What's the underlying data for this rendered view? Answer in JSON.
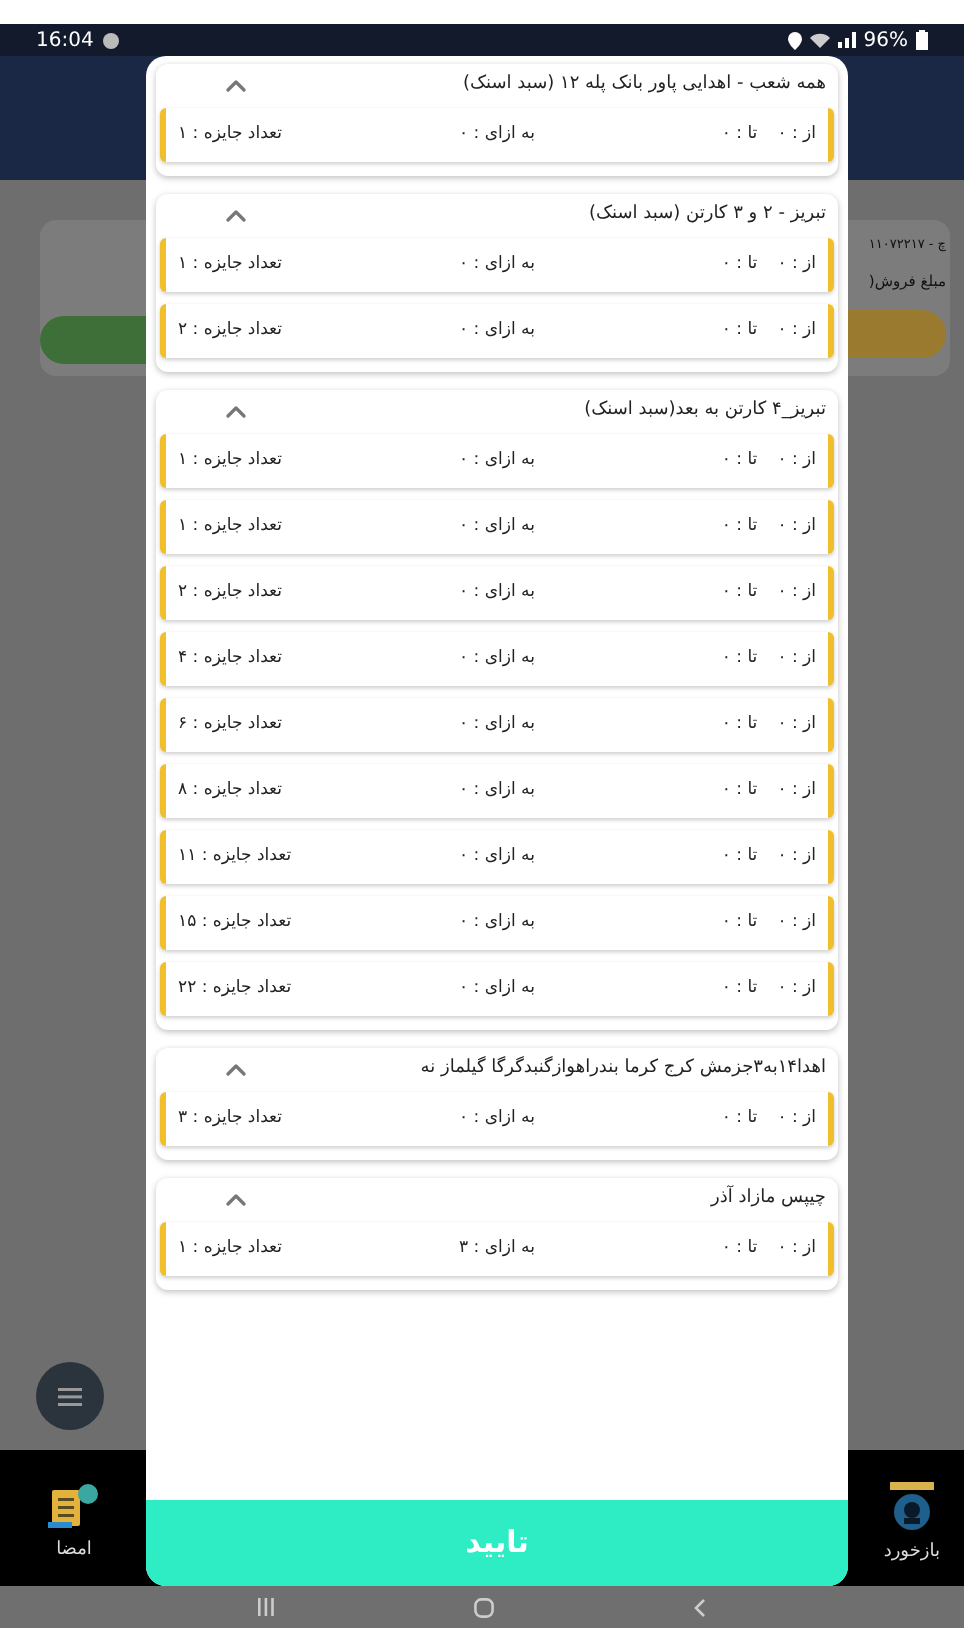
{
  "status_bar": {
    "time": "16:04",
    "battery": "96%"
  },
  "background": {
    "order_number": "چ - ۱۱۰۷۲۲۱۷",
    "amount_label": "مبلغ فروش("
  },
  "bottom_nav": [
    {
      "kind": "feedback",
      "label": "بازخورد"
    },
    {
      "kind": "signature",
      "label": "امضا"
    }
  ],
  "groups": [
    {
      "title": "همه شعب - اهدایی پاور بانک پله ۱۲ (سبد اسنک)",
      "expanded": true,
      "rows": [
        {
          "from": "از : ۰",
          "to": "تا : ۰",
          "per": "به ازای : ۰",
          "count": "تعداد جایزه : ۱"
        }
      ]
    },
    {
      "title": "تبریز - ۲ و ۳ کارتن  (سبد اسنک)",
      "expanded": true,
      "rows": [
        {
          "from": "از : ۰",
          "to": "تا : ۰",
          "per": "به ازای : ۰",
          "count": "تعداد جایزه : ۱"
        },
        {
          "from": "از : ۰",
          "to": "تا : ۰",
          "per": "به ازای : ۰",
          "count": "تعداد جایزه : ۲"
        }
      ]
    },
    {
      "title": "تبریز_۴ کارتن به بعد(سبد اسنک)",
      "expanded": true,
      "rows": [
        {
          "from": "از : ۰",
          "to": "تا : ۰",
          "per": "به ازای : ۰",
          "count": "تعداد جایزه : ۱"
        },
        {
          "from": "از : ۰",
          "to": "تا : ۰",
          "per": "به ازای : ۰",
          "count": "تعداد جایزه : ۱"
        },
        {
          "from": "از : ۰",
          "to": "تا : ۰",
          "per": "به ازای : ۰",
          "count": "تعداد جایزه : ۲"
        },
        {
          "from": "از : ۰",
          "to": "تا : ۰",
          "per": "به ازای : ۰",
          "count": "تعداد جایزه : ۴"
        },
        {
          "from": "از : ۰",
          "to": "تا : ۰",
          "per": "به ازای : ۰",
          "count": "تعداد جایزه : ۶"
        },
        {
          "from": "از : ۰",
          "to": "تا : ۰",
          "per": "به ازای : ۰",
          "count": "تعداد جایزه : ۸"
        },
        {
          "from": "از : ۰",
          "to": "تا : ۰",
          "per": "به ازای : ۰",
          "count": "تعداد جایزه : ۱۱"
        },
        {
          "from": "از : ۰",
          "to": "تا : ۰",
          "per": "به ازای : ۰",
          "count": "تعداد جایزه : ۱۵"
        },
        {
          "from": "از : ۰",
          "to": "تا : ۰",
          "per": "به ازای : ۰",
          "count": "تعداد جایزه : ۲۲"
        }
      ]
    },
    {
      "title": "اهدا۱۴به۳جزمش کرج کرما بندراهوازگنبدگرگا گیلماز نه",
      "expanded": true,
      "rows": [
        {
          "from": "از : ۰",
          "to": "تا : ۰",
          "per": "به ازای : ۰",
          "count": "تعداد جایزه : ۳"
        }
      ]
    },
    {
      "title": "چیپس مازاد آذر",
      "expanded": true,
      "rows": [
        {
          "from": "از : ۰",
          "to": "تا : ۰",
          "per": "به ازای : ۳",
          "count": "تعداد جایزه : ۱"
        }
      ]
    }
  ],
  "confirm_button": "تایید"
}
